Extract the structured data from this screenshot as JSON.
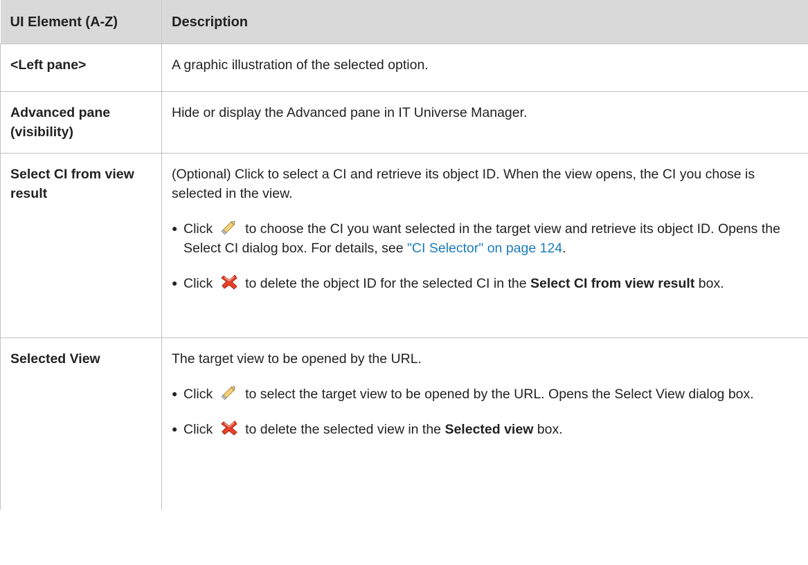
{
  "header": {
    "col_element": "UI Element (A-Z)",
    "col_description": "Description"
  },
  "rows": [
    {
      "element": "<Left pane>",
      "description": "A graphic illustration of the selected option."
    },
    {
      "element": "Advanced pane (visibility)",
      "description": "Hide or display the Advanced pane in IT Universe Manager."
    },
    {
      "element": "Select CI from view result",
      "description": "(Optional) Click to select a CI and retrieve its object ID. When the view opens, the CI you chose is selected in the view.",
      "bullets": [
        {
          "prefix": "Click",
          "icon": "pencil-icon",
          "text": "to choose the CI you want selected in the target view and retrieve its object ID. Opens the Select CI dialog box. For details, see ",
          "link": "\"CI Selector\" on page 124",
          "suffix": "."
        },
        {
          "prefix": "Click",
          "icon": "delete-x-icon",
          "text": "to delete the object ID for the selected CI in the ",
          "bold": "Select CI from view result",
          "suffix": " box."
        }
      ]
    },
    {
      "element": "Selected View",
      "description": "The target view to be opened by the URL.",
      "bullets": [
        {
          "prefix": "Click",
          "icon": "pencil-icon",
          "text": "to select the target view to be opened by the URL. Opens the Select View dialog box."
        },
        {
          "prefix": "Click",
          "icon": "delete-x-icon",
          "text": "to delete the selected view in the ",
          "bold": "Selected view",
          "suffix": " box."
        }
      ]
    }
  ],
  "colors": {
    "header_bg": "#d9d9d9",
    "link": "#1a7bb8",
    "delete_icon": "#e8402a"
  }
}
